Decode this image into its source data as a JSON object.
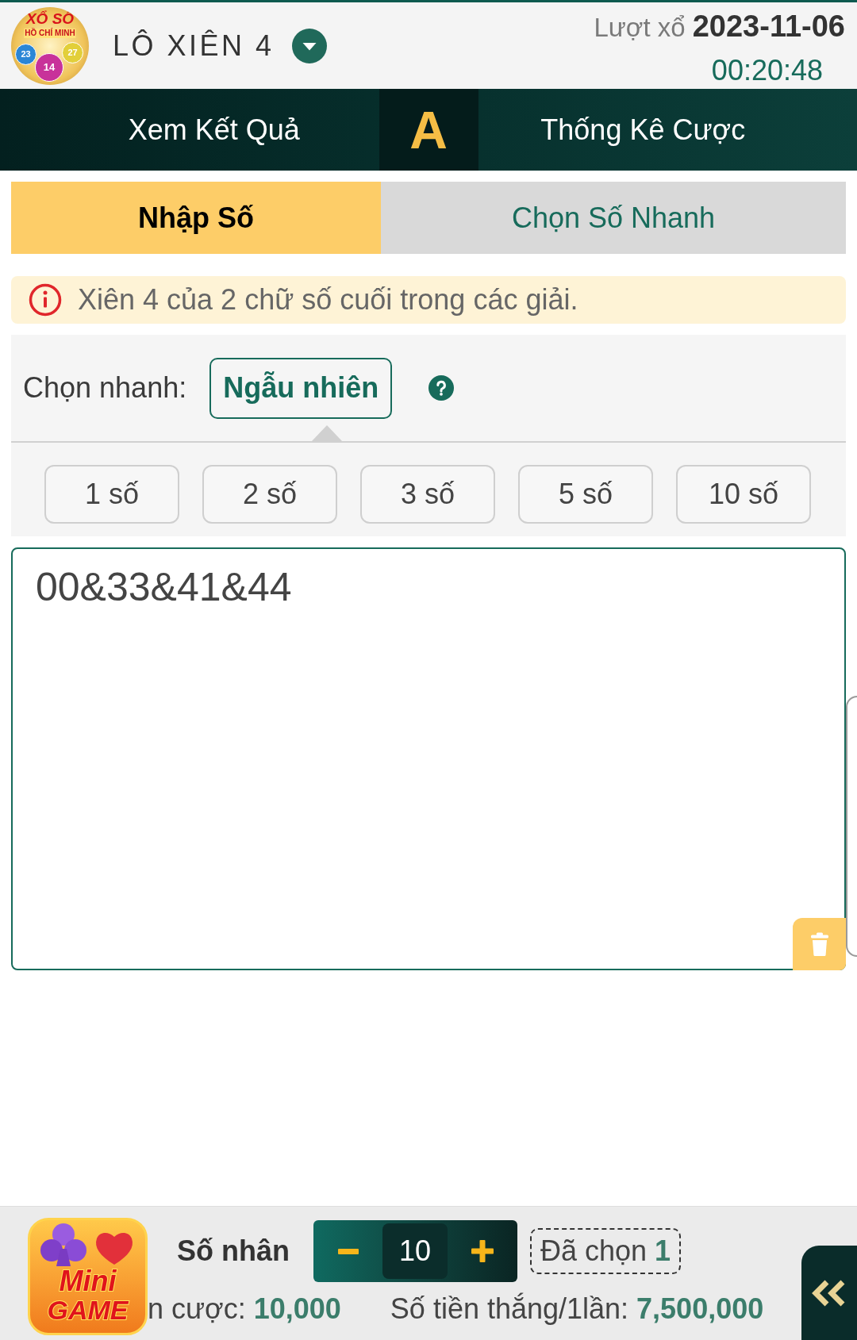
{
  "header": {
    "logo": {
      "title": "XỔ SỐ",
      "subtitle": "HỒ CHÍ MINH",
      "balls": [
        {
          "number": "23",
          "color": "#2b86d6"
        },
        {
          "number": "27",
          "color": "#e2cf3a"
        },
        {
          "number": "14",
          "color": "#c8329a"
        }
      ]
    },
    "title": "LÔ XIÊN 4",
    "draw_label": "Lượt xổ",
    "draw_date": "2023-11-06",
    "countdown": "00:20:48"
  },
  "nav": {
    "left": "Xem Kết Quả",
    "logo": "A",
    "right": "Thống Kê Cược"
  },
  "tabs": [
    {
      "label": "Nhập Số",
      "selected": true
    },
    {
      "label": "Chọn Số Nhanh",
      "selected": false
    }
  ],
  "notice": "Xiên 4 của 2 chữ số cuối trong các giải.",
  "quick_pick": {
    "label": "Chọn nhanh:",
    "random_button": "Ngẫu nhiên",
    "counts": [
      "1 số",
      "2 số",
      "3 số",
      "5 số",
      "10 số"
    ]
  },
  "numbers_input": {
    "value": "00&33&41&44"
  },
  "footer": {
    "mini_game": [
      "Mini",
      "GAME"
    ],
    "multiplier_label": "Số nhân",
    "multiplier": "10",
    "selected_label": "Đã chọn",
    "selected_count": "1",
    "stake_label": "n cược:",
    "stake": "10,000",
    "win_label": "Số tiền thắng/1lần:",
    "win": "7,500,000"
  }
}
